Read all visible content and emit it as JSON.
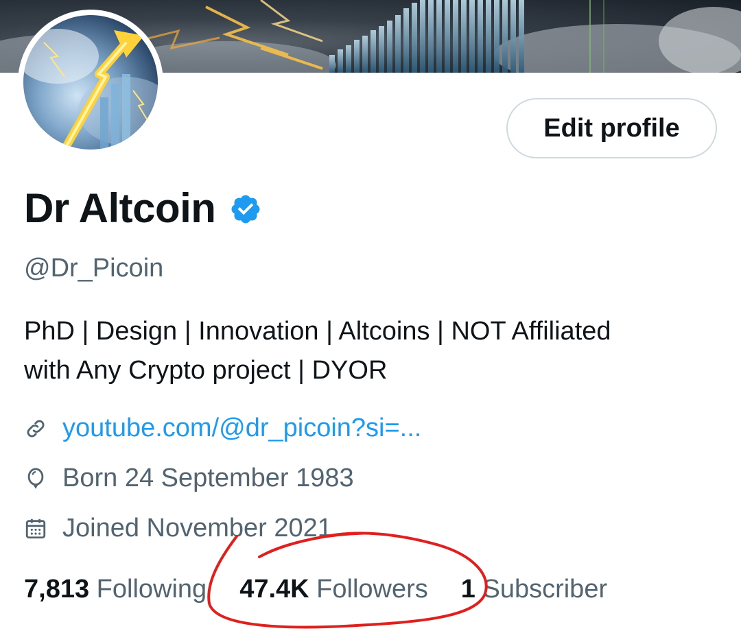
{
  "profile": {
    "display_name": "Dr Altcoin",
    "handle": "@Dr_Picoin",
    "bio_line_1": "PhD | Design | Innovation | Altcoins | NOT Affiliated",
    "bio_line_2": "with Any Crypto project | DYOR",
    "link": "youtube.com/@dr_picoin?si=...",
    "born": "Born 24 September 1983",
    "joined": "Joined November 2021"
  },
  "actions": {
    "edit_profile_label": "Edit profile"
  },
  "stats": {
    "following_count": "7,813",
    "following_label": "Following",
    "followers_count": "47.4K",
    "followers_label": "Followers",
    "subscribers_count": "1",
    "subscribers_label": "Subscriber"
  },
  "icons": {
    "verified": "verified-badge-icon",
    "link": "link-icon",
    "born": "balloon-icon",
    "joined": "calendar-icon"
  },
  "colors": {
    "accent": "#1d9bf0",
    "secondary_text": "#536471",
    "annotation": "#e0201e"
  }
}
